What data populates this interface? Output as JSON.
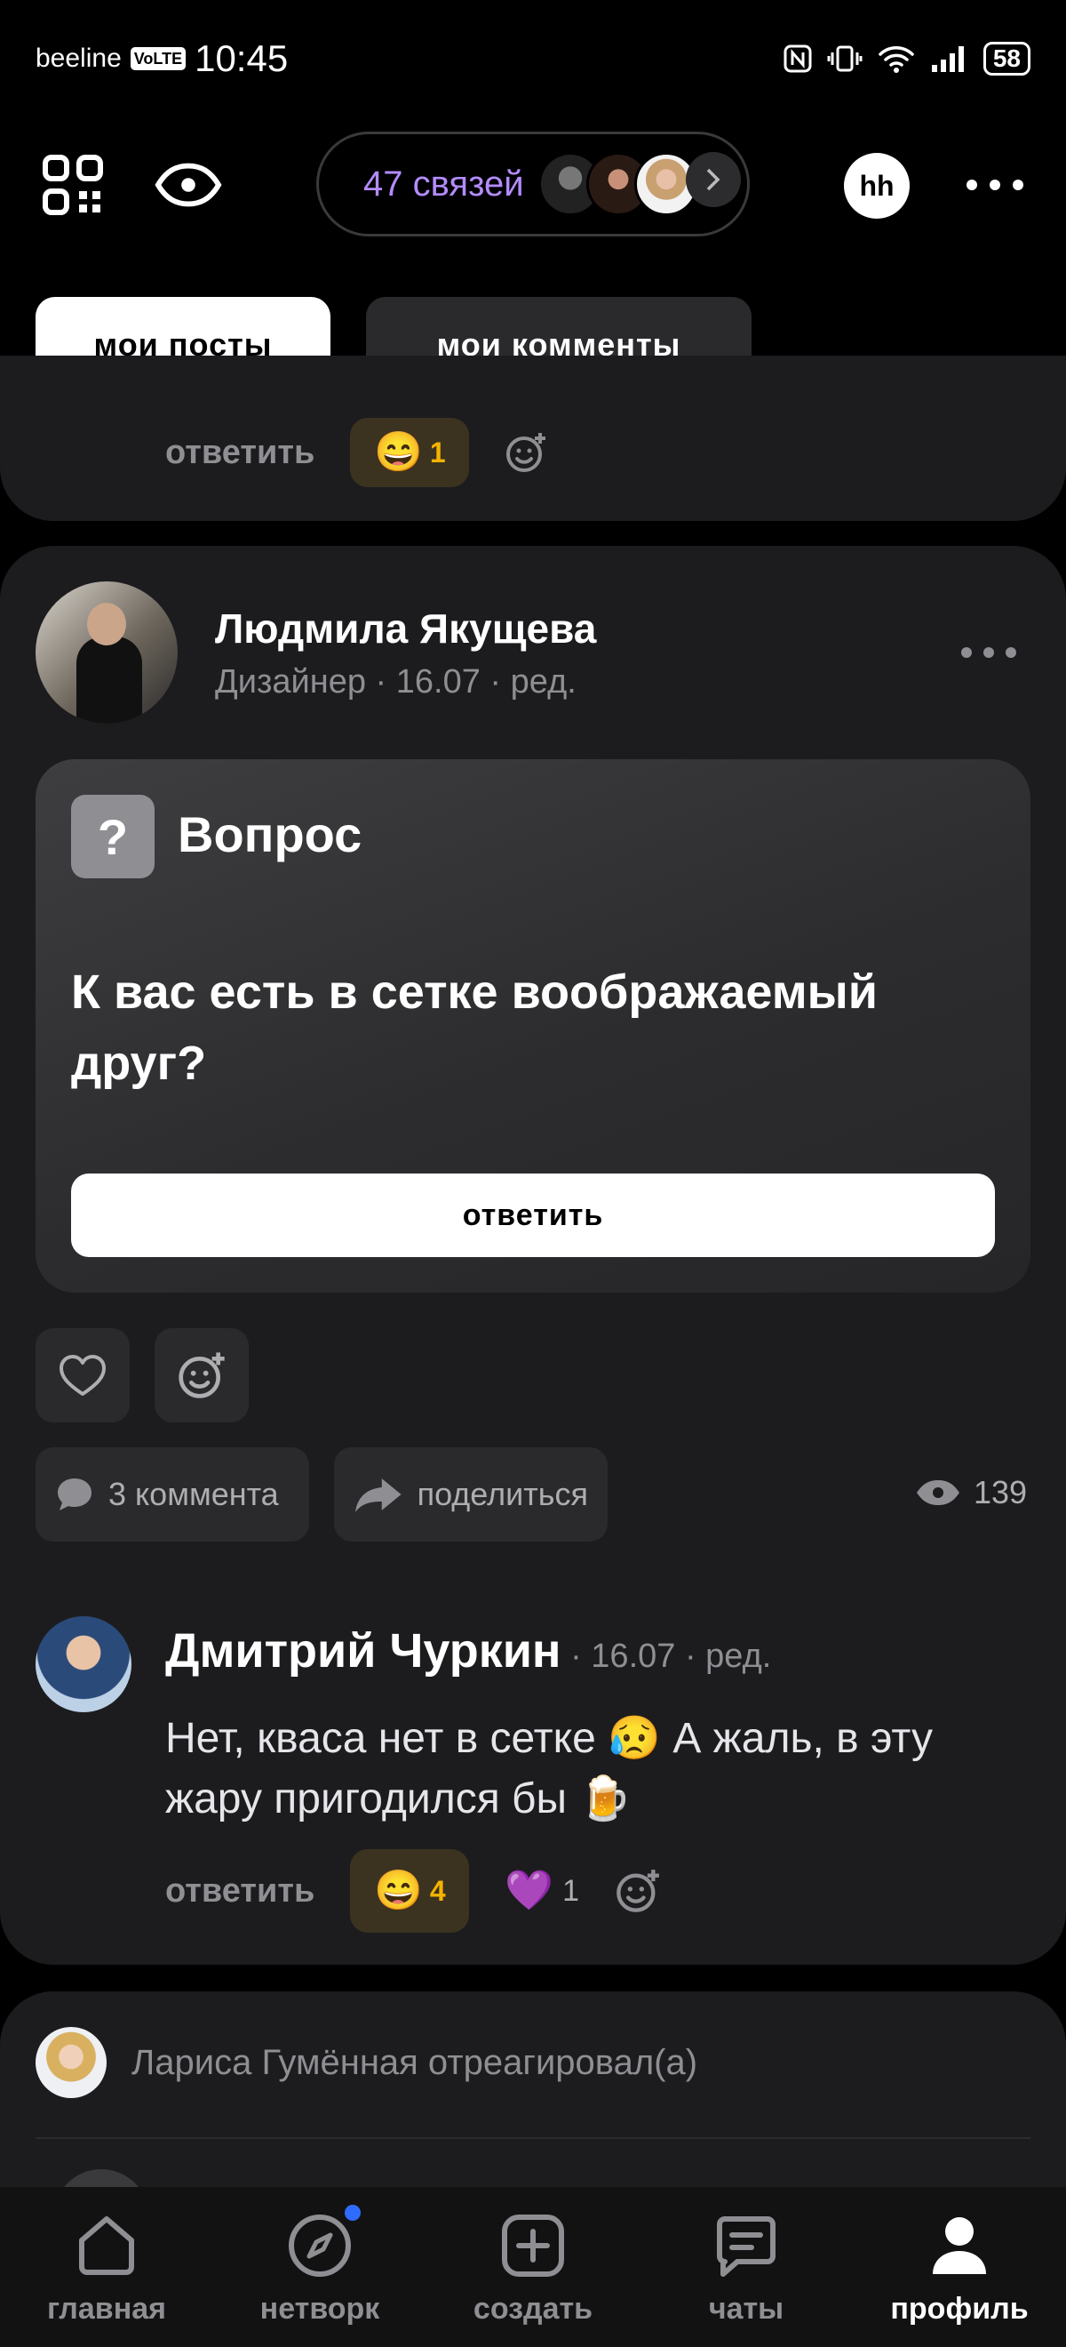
{
  "status_bar": {
    "carrier": "beeline",
    "network_badge": "VoLTE",
    "time": "10:45",
    "battery": "58"
  },
  "header": {
    "connections_label": "47 связей",
    "profile_initials": "hh"
  },
  "tabs": {
    "my_posts": "мои посты",
    "my_comments": "мои комменты"
  },
  "prev_post": {
    "reply_label": "ответить",
    "reaction_emoji": "😄",
    "reaction_count": "1"
  },
  "post": {
    "author_name": "Людмила Якущева",
    "author_meta": "Дизайнер · 16.07 · ред.",
    "question_badge": "?",
    "question_label": "Вопрос",
    "question_text": "К вас есть в сетке воображаемый друг?",
    "answer_button": "ответить",
    "comments_button": "3 коммента",
    "share_button": "поделиться",
    "views_count": "139"
  },
  "comment": {
    "author_name": "Дмитрий Чуркин",
    "meta": " · 16.07 · ред.",
    "text": "Нет, кваса нет в сетке 😥 А жаль, в эту жару пригодился бы 🍺",
    "reply_label": "ответить",
    "reaction1_emoji": "😄",
    "reaction1_count": "4",
    "reaction2_emoji": "💜",
    "reaction2_count": "1"
  },
  "activity": {
    "text": "Лариса Гумённая отреагировал(а)"
  },
  "bottom_nav": {
    "home": "главная",
    "network": "нетворк",
    "create": "создать",
    "chats": "чаты",
    "profile": "профиль"
  },
  "colors": {
    "accent_purple": "#b48cff",
    "reaction_gold": "#f5b300",
    "notification_blue": "#2f6bff",
    "card_bg": "#1c1c1e"
  }
}
